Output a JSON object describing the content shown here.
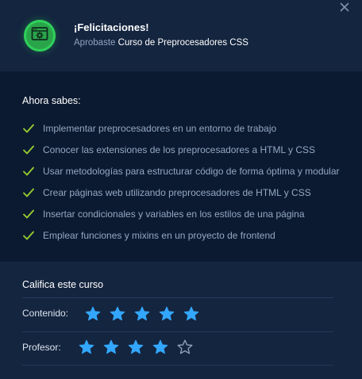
{
  "header": {
    "title": "¡Felicitaciones!",
    "approved_text": "Aprobaste",
    "course_name": "Curso de Preprocesadores CSS"
  },
  "learned": {
    "title": "Ahora sabes:",
    "items": [
      "Implementar preprocesadores en un entorno de trabajo",
      "Conocer las extensiones de los preprocesadores a HTML y CSS",
      "Usar metodologías para estructurar código de forma óptima y modular",
      "Crear páginas web utilizando preprocesadores de HTML y CSS",
      "Insertar condicionales y variables en los estilos de una página",
      "Emplear funciones y mixins en un proyecto de frontend"
    ]
  },
  "rating": {
    "title": "Califica este curso",
    "content_label": "Contenido:",
    "content_stars": 5,
    "teacher_label": "Profesor:",
    "teacher_stars": 4,
    "max_stars": 5
  },
  "colors": {
    "star_filled": "#33a7ff",
    "star_empty": "#8da0ba",
    "check": "#98d130",
    "badge": "#2aa44a"
  },
  "icons": {
    "close": "close-icon",
    "badge": "certificate-icon",
    "check": "check-icon",
    "star": "star-icon"
  }
}
